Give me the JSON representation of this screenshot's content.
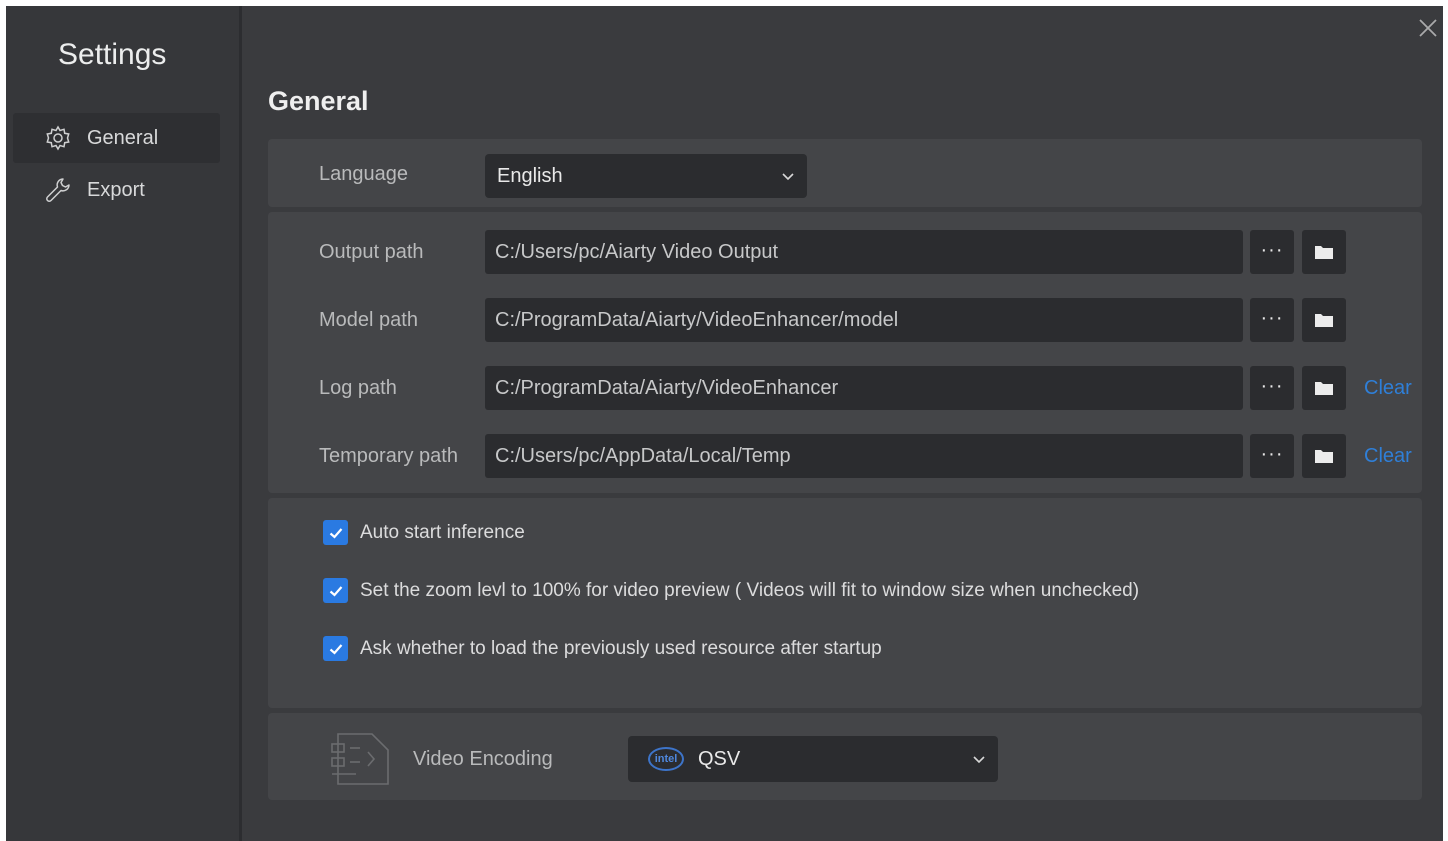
{
  "sidebar": {
    "title": "Settings",
    "items": [
      {
        "label": "General",
        "icon": "gear-icon",
        "active": true
      },
      {
        "label": "Export",
        "icon": "wrench-icon",
        "active": false
      }
    ]
  },
  "main": {
    "heading": "General",
    "language": {
      "label": "Language",
      "value": "English"
    },
    "paths": [
      {
        "label": "Output path",
        "value": "C:/Users/pc/Aiarty Video Output",
        "clear": ""
      },
      {
        "label": "Model path",
        "value": "C:/ProgramData/Aiarty/VideoEnhancer/model",
        "clear": ""
      },
      {
        "label": "Log path",
        "value": "C:/ProgramData/Aiarty/VideoEnhancer",
        "clear": "Clear"
      },
      {
        "label": "Temporary path",
        "value": "C:/Users/pc/AppData/Local/Temp",
        "clear": "Clear"
      }
    ],
    "options": [
      {
        "label": "Auto start inference",
        "checked": true
      },
      {
        "label": "Set the zoom levl to 100% for video preview ( Videos will fit to window size when unchecked)",
        "checked": true
      },
      {
        "label": "Ask whether to load the previously used resource after startup",
        "checked": true
      }
    ],
    "encoding": {
      "label": "Video Encoding",
      "value": "QSV",
      "badge": "intel"
    }
  },
  "buttons": {
    "browse": "···"
  },
  "colors": {
    "accent": "#2a7ae2",
    "link": "#2f7fd8",
    "background": "#3a3b3e",
    "card": "#444548",
    "field": "#2b2c2f"
  }
}
